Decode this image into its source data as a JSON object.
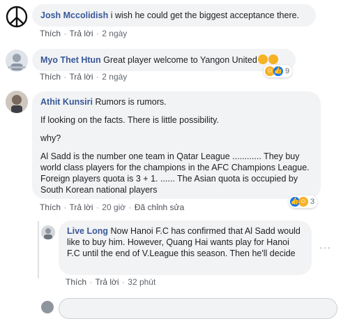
{
  "comments": [
    {
      "author": "Josh Mccolidish",
      "text": "i wish he could get the biggest acceptance there.",
      "like_label": "Thích",
      "reply_label": "Trả lời",
      "time": "2 ngày",
      "avatar_icon": "peace-sign-icon"
    },
    {
      "author": "Myo Thet Htun",
      "text": "Great player welcome to Yangon United",
      "like_label": "Thích",
      "reply_label": "Trả lời",
      "time": "2 ngày",
      "reaction_count": "9",
      "reaction_icons": [
        "haha-icon",
        "like-icon"
      ]
    },
    {
      "author": "Athit Kunsiri",
      "first_line": "Rumors is rumors.",
      "paragraphs": [
        "If looking on the facts. There is little possibility.",
        "why?",
        "Al Sadd is the number one team in Qatar League ............ They buy world class players for the champions in the AFC Champions League. Foreign players quota is 3 + 1. ...... The Asian quota is occupied by South Korean national players"
      ],
      "like_label": "Thích",
      "reply_label": "Trả lời",
      "time": "20 giờ",
      "edited_label": "Đã chỉnh sửa",
      "reaction_count": "3",
      "reaction_icons": [
        "like-icon",
        "haha-icon"
      ]
    }
  ],
  "reply": {
    "author": "Live Long",
    "text": "Now Hanoi F.C has confirmed that Al Sadd would like to buy him. However, Quang Hai wants play for Hanoi F.C until the end of V.League this season. Then he'll decide",
    "like_label": "Thích",
    "reply_label": "Trả lời",
    "time": "32 phút"
  },
  "colors": {
    "author": "#385898",
    "bubble": "#f2f3f5",
    "like": "#1877f2",
    "haha": "#f7b125"
  }
}
